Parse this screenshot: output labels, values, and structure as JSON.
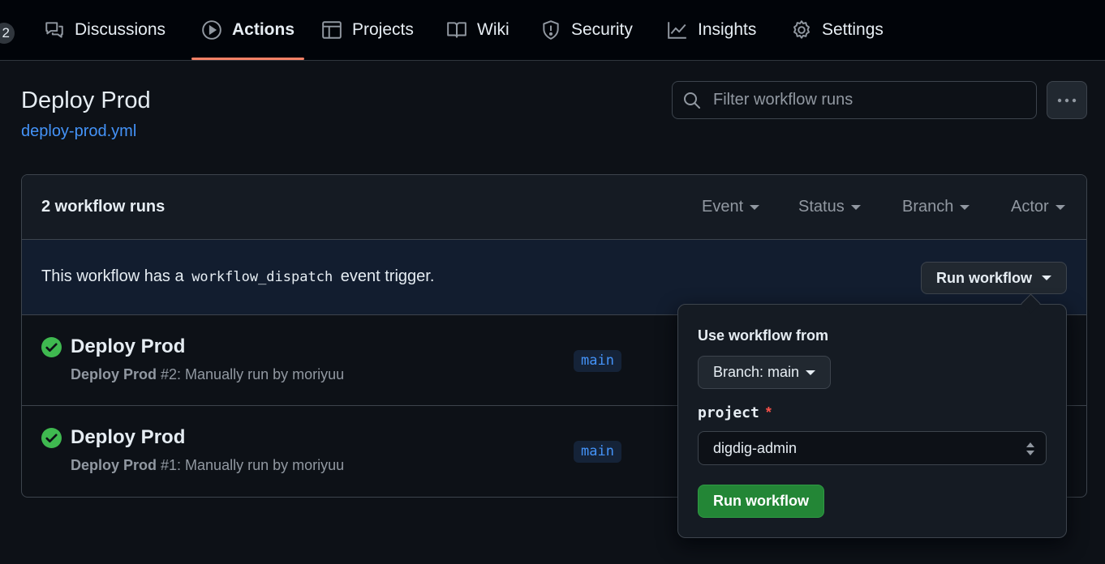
{
  "nav": {
    "count_badge": "2",
    "tabs": [
      {
        "label": "Discussions",
        "icon": "comment-discussion-icon"
      },
      {
        "label": "Actions",
        "icon": "play-icon",
        "active": true
      },
      {
        "label": "Projects",
        "icon": "table-icon"
      },
      {
        "label": "Wiki",
        "icon": "book-icon"
      },
      {
        "label": "Security",
        "icon": "shield-icon"
      },
      {
        "label": "Insights",
        "icon": "graph-icon"
      },
      {
        "label": "Settings",
        "icon": "gear-icon"
      }
    ],
    "active_underline_color": "#f78166"
  },
  "header": {
    "title": "Deploy Prod",
    "file_link": "deploy-prod.yml",
    "filter_placeholder": "Filter workflow runs"
  },
  "runs": {
    "count_label": "2 workflow runs",
    "filters": [
      "Event",
      "Status",
      "Branch",
      "Actor"
    ],
    "dispatch": {
      "prefix": "This workflow has a",
      "code": "workflow_dispatch",
      "suffix": "event trigger.",
      "button": "Run workflow"
    },
    "items": [
      {
        "title": "Deploy Prod",
        "sub_bold": "Deploy Prod",
        "sub_rest": " #2: Manually run by moriyuu",
        "branch": "main",
        "status": "success"
      },
      {
        "title": "Deploy Prod",
        "sub_bold": "Deploy Prod",
        "sub_rest": " #1: Manually run by moriyuu",
        "branch": "main",
        "status": "success"
      }
    ]
  },
  "popover": {
    "use_from_label": "Use workflow from",
    "branch_button": "Branch: main",
    "input_label": "project",
    "required_mark": "*",
    "input_value": "digdig-admin",
    "submit": "Run workflow"
  },
  "colors": {
    "background": "#0d1117",
    "link": "#4493f8",
    "success": "#3fb950",
    "primary_button": "#238636",
    "required": "#f85149"
  }
}
